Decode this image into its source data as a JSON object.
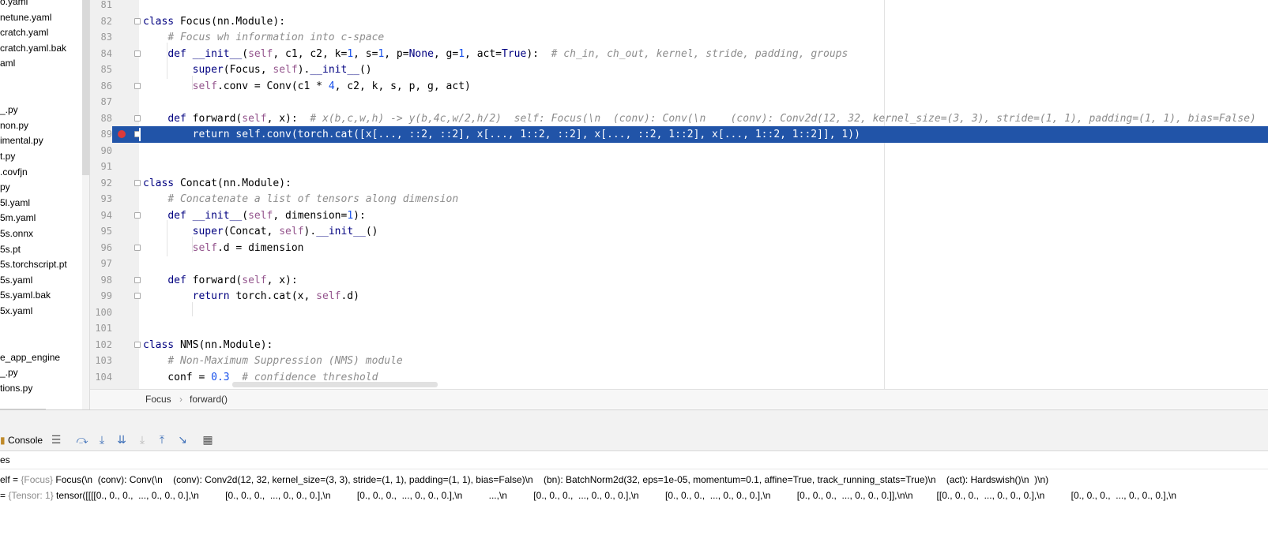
{
  "sidebar": {
    "items": [
      "o.yaml",
      "netune.yaml",
      "cratch.yaml",
      "cratch.yaml.bak",
      "aml",
      "",
      "",
      "_.py",
      "non.py",
      "imental.py",
      "t.py",
      ".covfjn",
      "py",
      "5l.yaml",
      "5m.yaml",
      "5s.onnx",
      "5s.pt",
      "5s.torchscript.pt",
      "5s.yaml",
      "5s.yaml.bak",
      "5x.yaml",
      "",
      "",
      "e_app_engine",
      "_.py",
      "tions.py"
    ]
  },
  "editor": {
    "lines": [
      {
        "no": "81",
        "html": ""
      },
      {
        "no": "82",
        "html": "<span class='k'>class</span> Focus(nn.Module):"
      },
      {
        "no": "83",
        "html": "    <span class='c'># Focus wh information into c-space</span>"
      },
      {
        "no": "84",
        "html": "    <span class='k'>def</span> <span class='sp'>__init__</span>(<span class='s'>self</span>, c1, c2, k=<span class='n'>1</span>, s=<span class='n'>1</span>, p=<span class='k'>None</span>, g=<span class='n'>1</span>, act=<span class='k'>True</span>):  <span class='c'># ch_in, ch_out, kernel, stride, padding, groups</span>"
      },
      {
        "no": "85",
        "html": "        <span class='b'>super</span>(Focus, <span class='s'>self</span>).<span class='sp'>__init__</span>()"
      },
      {
        "no": "86",
        "html": "        <span class='s'>self</span>.conv = Conv(c1 * <span class='n'>4</span>, c2, k, s, p, g, act)"
      },
      {
        "no": "87",
        "html": ""
      },
      {
        "no": "88",
        "html": "    <span class='k'>def</span> forward(<span class='s'>self</span>, x):  <span class='c'># x(b,c,w,h) -> y(b,4c,w/2,h/2)</span>  <span class='ann'>self: Focus(\\n  (conv): Conv(\\n    (conv): Conv2d(12, 32, kernel_size=(3, 3), stride=(1, 1), padding=(1, 1), bias=False)</span>"
      },
      {
        "no": "89",
        "html": "        return self.conv(torch.cat([x[..., ::2, ::2], x[..., 1::2, ::2], x[..., ::2, 1::2], x[..., 1::2, 1::2]], 1))"
      },
      {
        "no": "90",
        "html": ""
      },
      {
        "no": "91",
        "html": ""
      },
      {
        "no": "92",
        "html": "<span class='k'>class</span> Concat(nn.Module):"
      },
      {
        "no": "93",
        "html": "    <span class='c'># Concatenate a list of tensors along dimension</span>"
      },
      {
        "no": "94",
        "html": "    <span class='k'>def</span> <span class='sp'>__init__</span>(<span class='s'>self</span>, dimension=<span class='n'>1</span>):"
      },
      {
        "no": "95",
        "html": "        <span class='b'>super</span>(Concat, <span class='s'>self</span>).<span class='sp'>__init__</span>()"
      },
      {
        "no": "96",
        "html": "        <span class='s'>self</span>.d = dimension"
      },
      {
        "no": "97",
        "html": ""
      },
      {
        "no": "98",
        "html": "    <span class='k'>def</span> forward(<span class='s'>self</span>, x):"
      },
      {
        "no": "99",
        "html": "        <span class='k'>return</span> torch.cat(x, <span class='s'>self</span>.d)"
      },
      {
        "no": "100",
        "html": ""
      },
      {
        "no": "101",
        "html": ""
      },
      {
        "no": "102",
        "html": "<span class='k'>class</span> NMS(nn.Module):"
      },
      {
        "no": "103",
        "html": "    <span class='c'># Non-Maximum Suppression (NMS) module</span>"
      },
      {
        "no": "104",
        "html": "    conf = <span class='n'>0.3</span>  <span class='c'># confidence threshold</span>"
      }
    ]
  },
  "breadcrumb": {
    "class_name": "Focus",
    "separator": "›",
    "method_name": "forward()"
  },
  "debug": {
    "console_label": "Console",
    "variables_label": "es",
    "self_row": {
      "name": "elf = ",
      "type": "{Focus}",
      "value": " Focus(\\n  (conv): Conv(\\n    (conv): Conv2d(12, 32, kernel_size=(3, 3), stride=(1, 1), padding=(1, 1), bias=False)\\n    (bn): BatchNorm2d(32, eps=1e-05, momentum=0.1, affine=True, track_running_stats=True)\\n    (act): Hardswish()\\n  )\\n)"
    },
    "x_row": {
      "name": "= ",
      "type": "{Tensor: 1}",
      "value": " tensor([[[[0., 0., 0.,  ..., 0., 0., 0.],\\n          [0., 0., 0.,  ..., 0., 0., 0.],\\n          [0., 0., 0.,  ..., 0., 0., 0.],\\n          ...,\\n          [0., 0., 0.,  ..., 0., 0., 0.],\\n          [0., 0., 0.,  ..., 0., 0., 0.],\\n          [0., 0., 0.,  ..., 0., 0., 0.]],\\n\\n         [[0., 0., 0.,  ..., 0., 0., 0.],\\n          [0., 0., 0.,  ..., 0., 0., 0.],\\n"
    }
  }
}
